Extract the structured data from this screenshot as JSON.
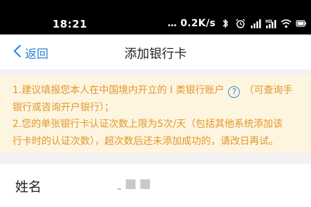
{
  "status_bar": {
    "time": "18:21",
    "dots": "...",
    "net_speed": "0.2K/s",
    "icons": [
      "bluetooth-icon",
      "alarm-icon",
      "signal-icon",
      "hd-signal-icon",
      "wifi-icon",
      "battery-icon"
    ]
  },
  "nav": {
    "back_label": "返回",
    "title": "添加银行卡"
  },
  "notice": {
    "line1_pre": "1.建议填报您本人在中国境内开立的 I 类银行账户",
    "line1_post": "（可查询手",
    "line2": "银行或咨询开户银行）；",
    "line3": "2.您的单张银行卡认证次数上限为5次/天（包括其他系统添加该",
    "line4": "行卡时的认证次数），超次数后还未添加成功的，请改日再试。",
    "help_glyph": "?"
  },
  "form": {
    "name_label": "姓名"
  },
  "colors": {
    "accent": "#2b7fd7",
    "notice_text": "#e2972c",
    "notice_bg": "#fdf5df"
  }
}
